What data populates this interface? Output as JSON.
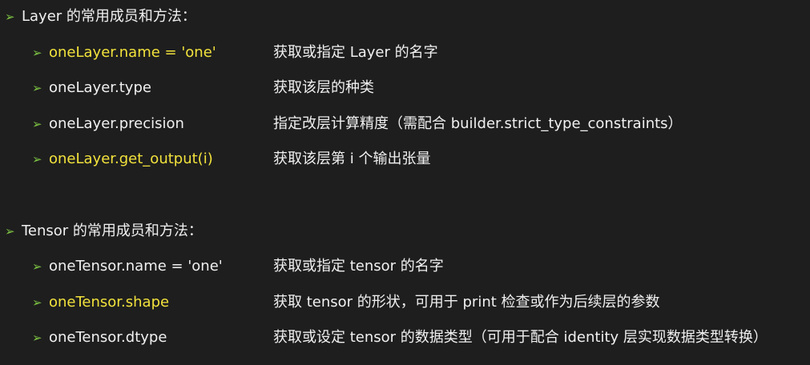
{
  "sections": [
    {
      "heading": "Layer 的常用成员和方法：",
      "items": [
        {
          "code": "oneLayer.name = 'one'",
          "desc": "获取或指定 Layer 的名字",
          "highlight": true
        },
        {
          "code": "oneLayer.type",
          "desc": "获取该层的种类",
          "highlight": false
        },
        {
          "code": "oneLayer.precision",
          "desc": "指定改层计算精度（需配合 builder.strict_type_constraints）",
          "highlight": false
        },
        {
          "code": "oneLayer.get_output(i)",
          "desc": "获取该层第 i 个输出张量",
          "highlight": true
        }
      ]
    },
    {
      "heading": "Tensor 的常用成员和方法：",
      "items": [
        {
          "code": "oneTensor.name = 'one'",
          "desc": "获取或指定 tensor 的名字",
          "highlight": false
        },
        {
          "code": "oneTensor.shape",
          "desc": "获取 tensor 的形状，可用于 print 检查或作为后续层的参数",
          "highlight": true
        },
        {
          "code": "oneTensor.dtype",
          "desc": "获取或设定 tensor 的数据类型（可用于配合 identity 层实现数据类型转换）",
          "highlight": false
        }
      ]
    }
  ],
  "bullet_icon": "green-arrow-bullet",
  "colors": {
    "background": "#1e1e1e",
    "text": "#f0f0f0",
    "highlight": "#f2e23c",
    "bullet": "#7cc242"
  }
}
